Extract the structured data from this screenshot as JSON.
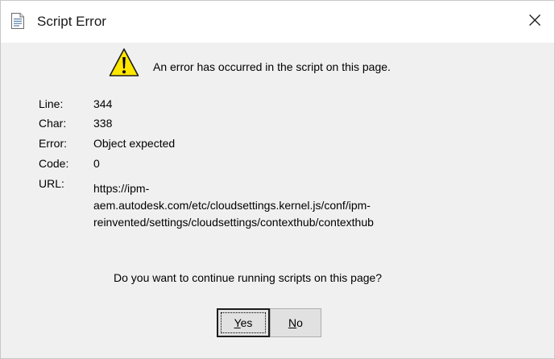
{
  "dialog": {
    "title": "Script Error",
    "title_icon": "document-icon",
    "close_icon": "close-icon",
    "headline": "An error has occurred in the script on this page.",
    "warning_icon": "warning-icon"
  },
  "details": {
    "line_label": "Line:",
    "line_value": "344",
    "char_label": "Char:",
    "char_value": "338",
    "error_label": "Error:",
    "error_value": "Object expected",
    "code_label": "Code:",
    "code_value": "0",
    "url_label": "URL:",
    "url_lines": [
      "https://ipm-",
      "aem.autodesk.com/etc/cloudsettings.kernel.js/conf/ipm-",
      "reinvented/settings/cloudsettings/contexthub/contexthub"
    ]
  },
  "question": "Do you want to continue running scripts on this page?",
  "buttons": {
    "yes_mnemonic": "Y",
    "yes_rest": "es",
    "no_mnemonic": "N",
    "no_rest": "o"
  },
  "colors": {
    "title_background": "#ffffff",
    "dialog_background": "#f0f0f0",
    "warning_yellow": "#ffe600"
  }
}
